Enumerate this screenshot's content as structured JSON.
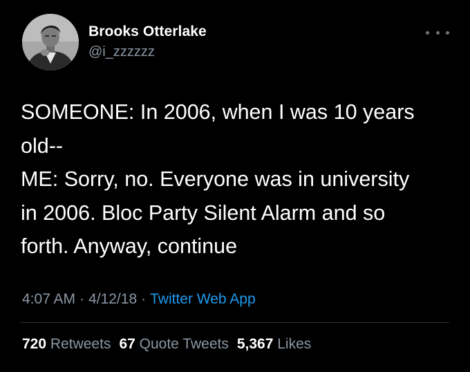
{
  "author": {
    "name": "Brooks Otterlake",
    "handle": "@i_zzzzzz"
  },
  "tweet": {
    "lines": [
      "SOMEONE: In 2006, when I was 10 years",
      "old--",
      "ME: Sorry, no. Everyone was in university",
      "in 2006. Bloc Party Silent Alarm and so",
      "forth. Anyway, continue"
    ]
  },
  "meta": {
    "time": "4:07 AM",
    "date": "4/12/18",
    "separator": "·",
    "source": "Twitter Web App"
  },
  "stats": {
    "retweets_count": "720",
    "retweets_label": "Retweets",
    "quotes_count": "67",
    "quotes_label": "Quote Tweets",
    "likes_count": "5,367",
    "likes_label": "Likes"
  },
  "icons": {
    "more": "more-horizontal-icon"
  },
  "colors": {
    "background": "#000000",
    "text": "#ffffff",
    "muted": "#8b98a5",
    "link": "#1d9bf0",
    "divider": "#2f3336"
  }
}
